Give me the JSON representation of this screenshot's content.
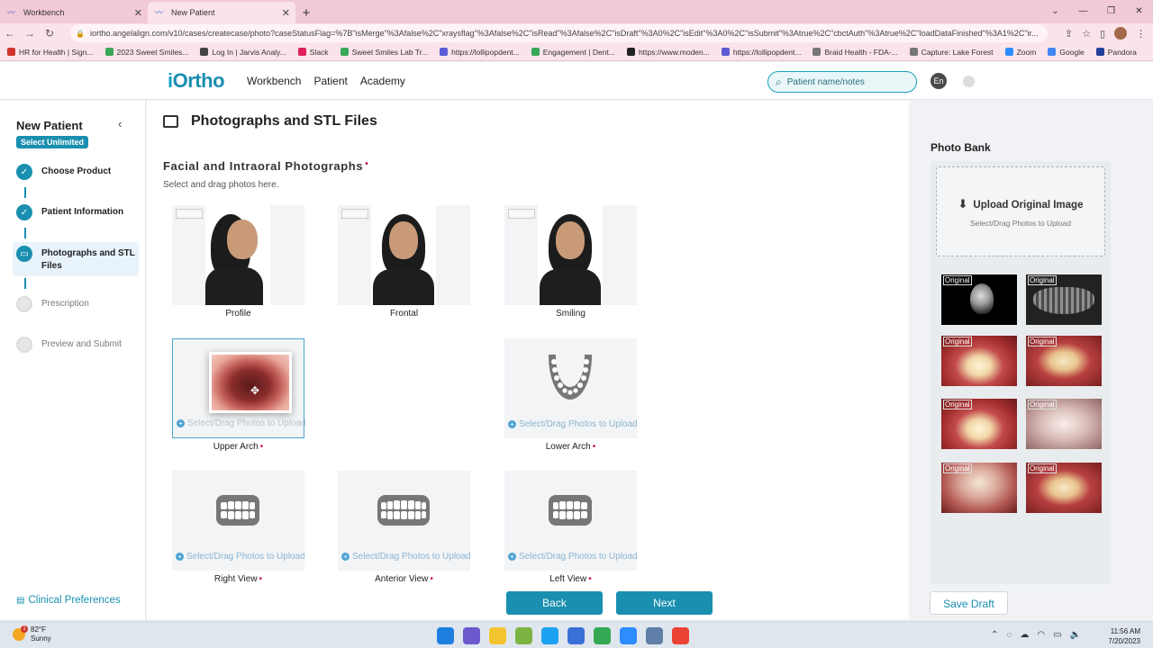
{
  "browser": {
    "tabs": [
      {
        "title": "Workbench",
        "active": false
      },
      {
        "title": "New Patient",
        "active": true
      }
    ],
    "url": "iortho.angelalign.com/v10/cases/createcase/photo?caseStatusFlag=%7B\"isMerge\"%3Afalse%2C\"xraysflag\"%3Afalse%2C\"isRead\"%3Afalse%2C\"isDraft\"%3A0%2C\"isEdit\"%3A0%2C\"isSubmit\"%3Atrue%2C\"cbctAuth\"%3Atrue%2C\"loadDataFinished\"%3A1%2C\"ir...",
    "bookmarks": [
      {
        "label": "HR for Health | Sign...",
        "color": "#d0342c"
      },
      {
        "label": "2023 Sweet Smiles...",
        "color": "#3aa757"
      },
      {
        "label": "Log In | Jarvis Analy...",
        "color": "#444"
      },
      {
        "label": "Slack",
        "color": "#e01e5a"
      },
      {
        "label": "Sweet Smiles Lab Tr...",
        "color": "#3aa757"
      },
      {
        "label": "https://lollipopdent...",
        "color": "#5b5bd6"
      },
      {
        "label": "Engagement | Dent...",
        "color": "#3aa757"
      },
      {
        "label": "https://www.moden...",
        "color": "#222"
      },
      {
        "label": "https://lollipopdent...",
        "color": "#5b5bd6"
      },
      {
        "label": "Braid Health - FDA-...",
        "color": "#777"
      },
      {
        "label": "Capture: Lake Forest",
        "color": "#777"
      },
      {
        "label": "Zoom",
        "color": "#2d8cff"
      },
      {
        "label": "Google",
        "color": "#4285f4"
      },
      {
        "label": "Pandora",
        "color": "#224099"
      }
    ]
  },
  "header": {
    "logo_i": "i",
    "logo_rest": "Ortho",
    "nav": [
      "Workbench",
      "Patient",
      "Academy"
    ],
    "search_placeholder": "Patient name/notes",
    "lang": "En"
  },
  "sidebar": {
    "title": "New Patient",
    "badge": "Select Unlimited",
    "steps": [
      {
        "label": "Choose Product",
        "state": "done"
      },
      {
        "label": "Patient Information",
        "state": "done"
      },
      {
        "label": "Photographs and STL Files",
        "state": "current"
      },
      {
        "label": "Prescription",
        "state": "todo"
      },
      {
        "label": "Preview and Submit",
        "state": "todo"
      }
    ],
    "footer": "Clinical Preferences"
  },
  "main": {
    "title": "Photographs and STL Files",
    "section_title": "Facial and Intraoral Photographs",
    "required_mark": "•",
    "section_sub": "Select and drag photos here.",
    "original_tag": "Original",
    "upload_hint": "Select/Drag Photos to Upload",
    "upload_hint_partial": "Select/Drag Photos to Upload",
    "slots": [
      {
        "label": "Profile",
        "required": false
      },
      {
        "label": "Frontal",
        "required": false
      },
      {
        "label": "Smiling",
        "required": false
      },
      {
        "label": "Upper Arch",
        "required": true
      },
      {
        "label": "Lower Arch",
        "required": true
      },
      {
        "label": "Right View",
        "required": true
      },
      {
        "label": "Anterior View",
        "required": true
      },
      {
        "label": "Left View",
        "required": true
      }
    ]
  },
  "photo_bank": {
    "title": "Photo Bank",
    "upload_label": "Upload Original Image",
    "upload_sub": "Select/Drag Photos to Upload",
    "thumb_tag": "Original"
  },
  "buttons": {
    "back": "Back",
    "next": "Next",
    "save_draft": "Save Draft"
  },
  "taskbar": {
    "temp": "82°F",
    "weather": "Sunny",
    "time": "11:56 AM",
    "date": "7/20/2023"
  },
  "colors": {
    "accent": "#1a8fb0",
    "required": "#c0143c"
  }
}
